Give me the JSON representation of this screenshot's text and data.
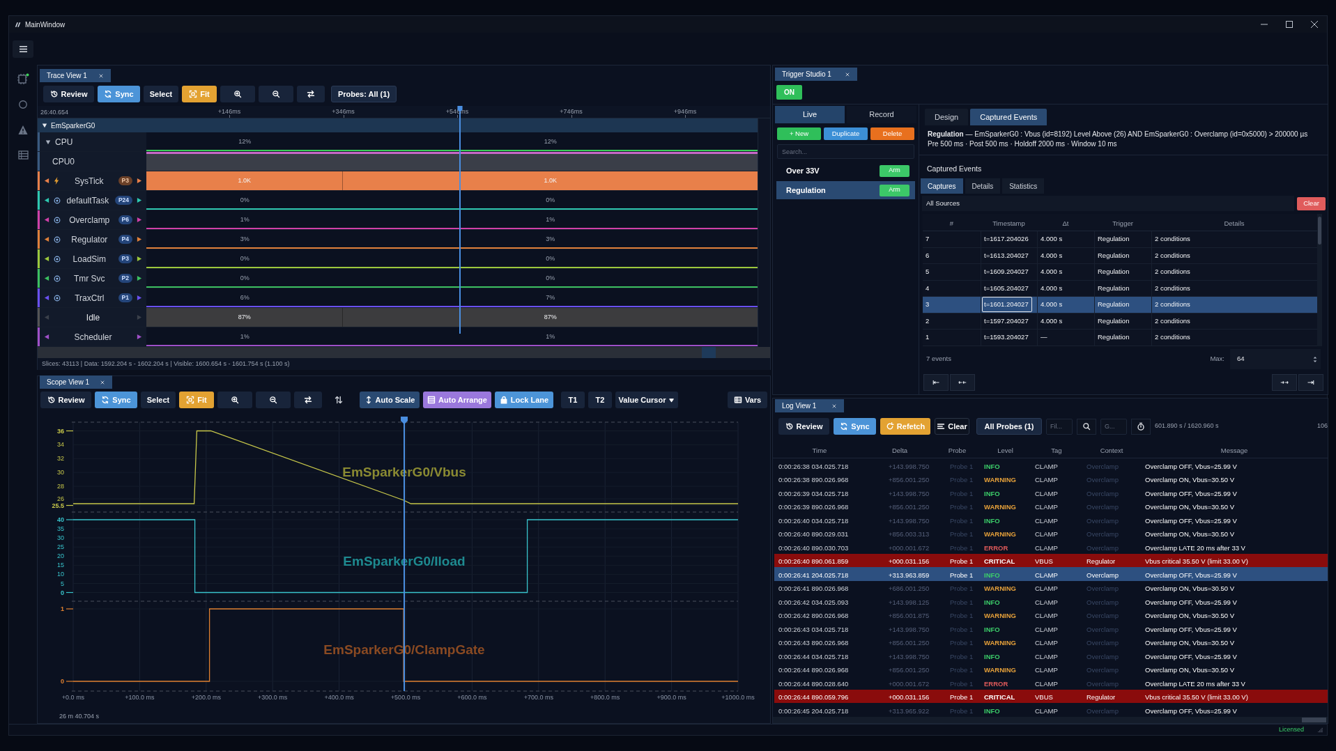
{
  "window": {
    "title": "MainWindow"
  },
  "trace_view": {
    "tab": "Trace View 1",
    "toolbar": [
      {
        "kind": "review",
        "label": "Review"
      },
      {
        "kind": "sync",
        "label": "Sync"
      },
      {
        "kind": "select",
        "label": "Select"
      },
      {
        "kind": "fit",
        "label": "Fit"
      },
      {
        "kind": "zoom_in"
      },
      {
        "kind": "zoom_out"
      },
      {
        "kind": "swap"
      },
      {
        "kind": "probes",
        "label": "Probes: All (1)"
      }
    ],
    "ruler": {
      "start": "26:40.654",
      "ticks": [
        "+146ms",
        "+346ms",
        "+546ms",
        "+746ms",
        "+946ms"
      ]
    },
    "tracks": [
      {
        "kind": "group",
        "label": "EmSparkerG0",
        "expanded": true
      },
      {
        "kind": "cpu",
        "label": "CPU",
        "expanded": true,
        "color": "#3ccf5a",
        "values": [
          "12%",
          "12%"
        ]
      },
      {
        "kind": "core",
        "label": "CPU0",
        "color": "#c868c8"
      },
      {
        "kind": "isr",
        "label": "SysTick",
        "badge": "P3",
        "color": "#e8804a",
        "values": [
          "1.0K",
          "1.0K"
        ]
      },
      {
        "kind": "task",
        "label": "defaultTask",
        "badge": "P24",
        "color": "#2ec8b0",
        "values": [
          "0%",
          "0%"
        ]
      },
      {
        "kind": "task",
        "label": "Overclamp",
        "badge": "P6",
        "color": "#d040a8",
        "values": [
          "1%",
          "1%"
        ]
      },
      {
        "kind": "task",
        "label": "Regulator",
        "badge": "P4",
        "color": "#e0803a",
        "values": [
          "3%",
          "3%"
        ]
      },
      {
        "kind": "task",
        "label": "LoadSim",
        "badge": "P3",
        "color": "#9cc83c",
        "values": [
          "0%",
          "0%"
        ]
      },
      {
        "kind": "task",
        "label": "Tmr Svc",
        "badge": "P2",
        "color": "#3cc060",
        "values": [
          "0%",
          "0%"
        ]
      },
      {
        "kind": "task",
        "label": "TraxCtrl",
        "badge": "P1",
        "color": "#6a50f0",
        "values": [
          "6%",
          "7%"
        ]
      },
      {
        "kind": "idle",
        "label": "Idle",
        "color": "#3c3c3e",
        "values": [
          "87%",
          "87%"
        ]
      },
      {
        "kind": "scheduler",
        "label": "Scheduler",
        "color": "#a050c8",
        "values": [
          "1%",
          "1%"
        ]
      }
    ],
    "status": "Slices: 43113 | Data: 1592.204 s - 1602.204 s | Visible: 1600.654 s - 1601.754 s (1.100 s)"
  },
  "scope_view": {
    "tab": "Scope View 1",
    "toolbar": [
      {
        "kind": "review",
        "label": "Review"
      },
      {
        "kind": "sync",
        "label": "Sync"
      },
      {
        "kind": "select",
        "label": "Select"
      },
      {
        "kind": "fit",
        "label": "Fit"
      },
      {
        "kind": "zoom_in"
      },
      {
        "kind": "zoom_out"
      },
      {
        "kind": "swap"
      },
      {
        "kind": "swap_vertical"
      },
      {
        "kind": "auto_scale",
        "label": "Auto Scale"
      },
      {
        "kind": "auto_arrange",
        "label": "Auto Arrange"
      },
      {
        "kind": "lock_lane",
        "label": "Lock Lane"
      },
      {
        "kind": "t1",
        "label": "T1"
      },
      {
        "kind": "t2",
        "label": "T2"
      },
      {
        "kind": "value_cursor",
        "label": "Value Cursor"
      },
      {
        "kind": "vars",
        "label": "Vars"
      }
    ],
    "lanes": [
      {
        "name": "EmSparkerG0/Vbus",
        "color": "#c8c84a",
        "y_labels": [
          "36",
          "34",
          "32",
          "30",
          "28",
          "26",
          "25.5"
        ]
      },
      {
        "name": "EmSparkerG0/Iload",
        "color": "#38c4cc",
        "y_labels": [
          "40",
          "35",
          "30",
          "25",
          "20",
          "15",
          "10",
          "5",
          "0"
        ]
      },
      {
        "name": "EmSparkerG0/ClampGate",
        "color": "#e08030",
        "y_labels": [
          "1",
          "0"
        ]
      }
    ],
    "x_labels": [
      "+0.0 ms",
      "+100.0 ms",
      "+200.0 ms",
      "+300.0 ms",
      "+400.0 ms",
      "+500.0 ms",
      "+600.0 ms",
      "+700.0 ms",
      "+800.0 ms",
      "+900.0 ms",
      "+1000.0 ms"
    ],
    "time_origin": "26 m 40.704 s"
  },
  "trigger_studio": {
    "tab": "Trigger Studio 1",
    "power": {
      "label": "ON",
      "on": true
    },
    "mode_tabs": [
      {
        "label": "Live",
        "selected": true
      },
      {
        "label": "Record",
        "selected": false
      }
    ],
    "actions": [
      {
        "kind": "new",
        "label": "+ New"
      },
      {
        "kind": "duplicate",
        "label": "Duplicate"
      },
      {
        "kind": "delete",
        "label": "Delete"
      }
    ],
    "search": {
      "placeholder": "Search..."
    },
    "triggers": [
      {
        "name": "Over 33V",
        "arm": "Arm",
        "selected": false
      },
      {
        "name": "Regulation",
        "arm": "Arm",
        "selected": true
      }
    ],
    "view_tabs": [
      {
        "label": "Design",
        "selected": false
      },
      {
        "label": "Captured Events",
        "selected": true
      }
    ],
    "summary": "**Regulation** — EmSparkerG0 : Vbus (id=8192) Level Above (26) AND EmSparkerG0 : Overclamp (id=0x5000) > 200000 µs",
    "settings": "Pre 500 ms · Post 500 ms · Holdoff 2000 ms · Window 10 ms",
    "captured_title": "Captured Events",
    "sub_tabs": [
      {
        "label": "Captures",
        "selected": true
      },
      {
        "label": "Details",
        "selected": false
      },
      {
        "label": "Statistics",
        "selected": false
      }
    ],
    "source_filter": "All Sources",
    "clear": "Clear",
    "table": {
      "columns": [
        "#",
        "Timestamp",
        "Δt",
        "Trigger",
        "Details"
      ],
      "rows": [
        {
          "cells": [
            "7",
            "t=1617.204026",
            "4.000 s",
            "Regulation",
            "2 conditions"
          ],
          "selected": false
        },
        {
          "cells": [
            "6",
            "t=1613.204027",
            "4.000 s",
            "Regulation",
            "2 conditions"
          ],
          "selected": false
        },
        {
          "cells": [
            "5",
            "t=1609.204027",
            "4.000 s",
            "Regulation",
            "2 conditions"
          ],
          "selected": false
        },
        {
          "cells": [
            "4",
            "t=1605.204027",
            "4.000 s",
            "Regulation",
            "2 conditions"
          ],
          "selected": false
        },
        {
          "cells": [
            "3",
            "t=1601.204027",
            "4.000 s",
            "Regulation",
            "2 conditions"
          ],
          "selected": true
        },
        {
          "cells": [
            "2",
            "t=1597.204027",
            "4.000 s",
            "Regulation",
            "2 conditions"
          ],
          "selected": false
        },
        {
          "cells": [
            "1",
            "t=1593.204027",
            "—",
            "Regulation",
            "2 conditions"
          ],
          "selected": false
        }
      ]
    },
    "count": "7 events",
    "max": {
      "label": "Max:",
      "value": "64"
    }
  },
  "log_view": {
    "tab": "Log View 1",
    "toolbar": [
      {
        "kind": "review",
        "label": "Review"
      },
      {
        "kind": "sync",
        "label": "Sync"
      },
      {
        "kind": "refetch",
        "label": "Refetch"
      },
      {
        "kind": "clear",
        "label": "Clear"
      },
      {
        "kind": "probes",
        "label": "All Probes (1)"
      }
    ],
    "filter": {
      "placeholder": "Fil..."
    },
    "goto": {
      "placeholder": "G..."
    },
    "range": "601.890 s / 1620.960 s",
    "overflow": "106",
    "columns": [
      "Time",
      "Delta",
      "Probe",
      "Level",
      "Tag",
      "Context",
      "Message"
    ],
    "rows": [
      {
        "kind": "info",
        "time": "0:00:26:38 034.025.718",
        "delta": "+143.998.750",
        "probe": "Probe 1",
        "level_text": "INFO",
        "tag": "CLAMP",
        "context": "Overclamp",
        "message": "Overclamp OFF, Vbus=25.99 V",
        "selected": false
      },
      {
        "kind": "warning",
        "time": "0:00:26:38 890.026.968",
        "delta": "+856.001.250",
        "probe": "Probe 1",
        "level_text": "WARNING",
        "tag": "CLAMP",
        "context": "Overclamp",
        "message": "Overclamp ON, Vbus=30.50 V",
        "selected": false
      },
      {
        "kind": "info",
        "time": "0:00:26:39 034.025.718",
        "delta": "+143.998.750",
        "probe": "Probe 1",
        "level_text": "INFO",
        "tag": "CLAMP",
        "context": "Overclamp",
        "message": "Overclamp OFF, Vbus=25.99 V",
        "selected": false
      },
      {
        "kind": "warning",
        "time": "0:00:26:39 890.026.968",
        "delta": "+856.001.250",
        "probe": "Probe 1",
        "level_text": "WARNING",
        "tag": "CLAMP",
        "context": "Overclamp",
        "message": "Overclamp ON, Vbus=30.50 V",
        "selected": false
      },
      {
        "kind": "info",
        "time": "0:00:26:40 034.025.718",
        "delta": "+143.998.750",
        "probe": "Probe 1",
        "level_text": "INFO",
        "tag": "CLAMP",
        "context": "Overclamp",
        "message": "Overclamp OFF, Vbus=25.99 V",
        "selected": false
      },
      {
        "kind": "warning",
        "time": "0:00:26:40 890.029.031",
        "delta": "+856.003.313",
        "probe": "Probe 1",
        "level_text": "WARNING",
        "tag": "CLAMP",
        "context": "Overclamp",
        "message": "Overclamp ON, Vbus=30.50 V",
        "selected": false
      },
      {
        "kind": "error",
        "time": "0:00:26:40 890.030.703",
        "delta": "+000.001.672",
        "probe": "Probe 1",
        "level_text": "ERROR",
        "tag": "CLAMP",
        "context": "Overclamp",
        "message": "Overclamp LATE 20 ms after 33 V",
        "selected": false
      },
      {
        "kind": "critical",
        "time": "0:00:26:40 890.061.859",
        "delta": "+000.031.156",
        "probe": "Probe 1",
        "level_text": "CRITICAL",
        "tag": "VBUS",
        "context": "Regulator",
        "message": "Vbus critical 35.50 V (limit 33.00 V)",
        "selected": false
      },
      {
        "kind": "info",
        "time": "0:00:26:41 204.025.718",
        "delta": "+313.963.859",
        "probe": "Probe 1",
        "level_text": "INFO",
        "tag": "CLAMP",
        "context": "Overclamp",
        "message": "Overclamp OFF, Vbus=25.99 V",
        "selected": true
      },
      {
        "kind": "warning",
        "time": "0:00:26:41 890.026.968",
        "delta": "+686.001.250",
        "probe": "Probe 1",
        "level_text": "WARNING",
        "tag": "CLAMP",
        "context": "Overclamp",
        "message": "Overclamp ON, Vbus=30.50 V",
        "selected": false
      },
      {
        "kind": "info",
        "time": "0:00:26:42 034.025.093",
        "delta": "+143.998.125",
        "probe": "Probe 1",
        "level_text": "INFO",
        "tag": "CLAMP",
        "context": "Overclamp",
        "message": "Overclamp OFF, Vbus=25.99 V",
        "selected": false
      },
      {
        "kind": "warning",
        "time": "0:00:26:42 890.026.968",
        "delta": "+856.001.875",
        "probe": "Probe 1",
        "level_text": "WARNING",
        "tag": "CLAMP",
        "context": "Overclamp",
        "message": "Overclamp ON, Vbus=30.50 V",
        "selected": false
      },
      {
        "kind": "info",
        "time": "0:00:26:43 034.025.718",
        "delta": "+143.998.750",
        "probe": "Probe 1",
        "level_text": "INFO",
        "tag": "CLAMP",
        "context": "Overclamp",
        "message": "Overclamp OFF, Vbus=25.99 V",
        "selected": false
      },
      {
        "kind": "warning",
        "time": "0:00:26:43 890.026.968",
        "delta": "+856.001.250",
        "probe": "Probe 1",
        "level_text": "WARNING",
        "tag": "CLAMP",
        "context": "Overclamp",
        "message": "Overclamp ON, Vbus=30.50 V",
        "selected": false
      },
      {
        "kind": "info",
        "time": "0:00:26:44 034.025.718",
        "delta": "+143.998.750",
        "probe": "Probe 1",
        "level_text": "INFO",
        "tag": "CLAMP",
        "context": "Overclamp",
        "message": "Overclamp OFF, Vbus=25.99 V",
        "selected": false
      },
      {
        "kind": "warning",
        "time": "0:00:26:44 890.026.968",
        "delta": "+856.001.250",
        "probe": "Probe 1",
        "level_text": "WARNING",
        "tag": "CLAMP",
        "context": "Overclamp",
        "message": "Overclamp ON, Vbus=30.50 V",
        "selected": false
      },
      {
        "kind": "error",
        "time": "0:00:26:44 890.028.640",
        "delta": "+000.001.672",
        "probe": "Probe 1",
        "level_text": "ERROR",
        "tag": "CLAMP",
        "context": "Overclamp",
        "message": "Overclamp LATE 20 ms after 33 V",
        "selected": false
      },
      {
        "kind": "critical",
        "time": "0:00:26:44 890.059.796",
        "delta": "+000.031.156",
        "probe": "Probe 1",
        "level_text": "CRITICAL",
        "tag": "VBUS",
        "context": "Regulator",
        "message": "Vbus critical 35.50 V (limit 33.00 V)",
        "selected": false
      },
      {
        "kind": "info",
        "time": "0:00:26:45 204.025.718",
        "delta": "+313.965.922",
        "probe": "Probe 1",
        "level_text": "INFO",
        "tag": "CLAMP",
        "context": "Overclamp",
        "message": "Overclamp OFF, Vbus=25.99 V",
        "selected": false
      }
    ]
  },
  "status_bar": {
    "license": "Licensed"
  }
}
